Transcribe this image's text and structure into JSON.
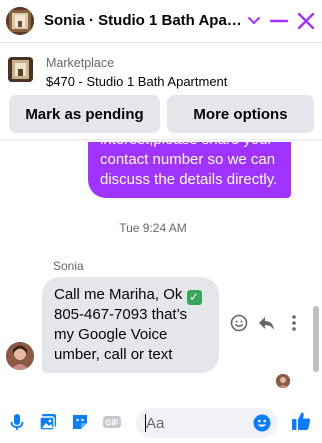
{
  "header": {
    "title": "Sonia · Studio 1 Bath Apart…",
    "accent_color": "#a033ff"
  },
  "marketplace": {
    "label": "Marketplace",
    "listing": "$470 - Studio 1 Bath Apartment",
    "mark_pending_label": "Mark as pending",
    "more_options_label": "More options"
  },
  "messages": {
    "sent_text": "interest,please share your contact number so we can discuss the details directly.",
    "timestamp": "Tue 9:24 AM",
    "sender_name": "Sonia",
    "received_text_before": "Call me Mariha, Ok ",
    "received_check": "✓",
    "received_text_after": " 805-467-7093 that’s my Google Voice umber, call or text"
  },
  "composer": {
    "placeholder": "Aa",
    "icons": [
      "microphone-icon",
      "photo-icon",
      "sticker-icon",
      "gif-icon",
      "emoji-icon",
      "thumbs-up-icon"
    ]
  },
  "colors": {
    "accent": "#a033ff",
    "bubble_received": "#e4e6eb",
    "icon_blue": "#0a7cff"
  }
}
